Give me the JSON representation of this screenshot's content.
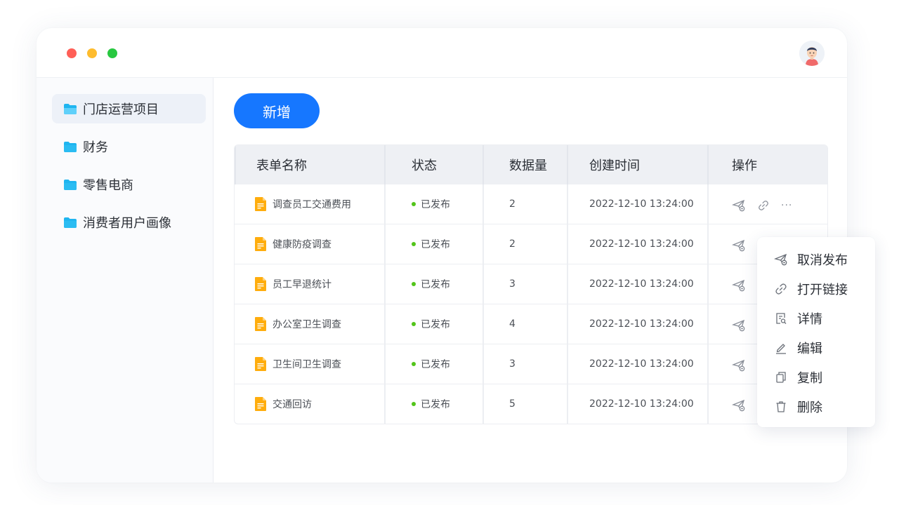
{
  "window": {
    "controls": [
      "close",
      "minimize",
      "maximize"
    ]
  },
  "sidebar": {
    "items": [
      {
        "label": "门店运营项目",
        "active": true,
        "icon": "folder-open-icon"
      },
      {
        "label": "财务",
        "active": false,
        "icon": "folder-icon"
      },
      {
        "label": "零售电商",
        "active": false,
        "icon": "folder-icon"
      },
      {
        "label": "消费者用户画像",
        "active": false,
        "icon": "folder-icon"
      }
    ]
  },
  "toolbar": {
    "add_label": "新增"
  },
  "table": {
    "headers": [
      "表单名称",
      "状态",
      "数据量",
      "创建时间",
      "操作"
    ],
    "rows": [
      {
        "name": "调查员工交通费用",
        "status": "已发布",
        "count": "2",
        "created": "2022-12-10 13:24:00"
      },
      {
        "name": "健康防疫调查",
        "status": "已发布",
        "count": "2",
        "created": "2022-12-10 13:24:00"
      },
      {
        "name": "员工早退统计",
        "status": "已发布",
        "count": "3",
        "created": "2022-12-10 13:24:00"
      },
      {
        "name": "办公室卫生调查",
        "status": "已发布",
        "count": "4",
        "created": "2022-12-10 13:24:00"
      },
      {
        "name": "卫生间卫生调查",
        "status": "已发布",
        "count": "3",
        "created": "2022-12-10 13:24:00"
      },
      {
        "name": "交通回访",
        "status": "已发布",
        "count": "5",
        "created": "2022-12-10 13:24:00"
      }
    ],
    "more_label": "···"
  },
  "menu": {
    "items": [
      {
        "label": "取消发布",
        "icon": "unpublish-icon"
      },
      {
        "label": "打开链接",
        "icon": "link-icon"
      },
      {
        "label": "详情",
        "icon": "details-icon"
      },
      {
        "label": "编辑",
        "icon": "edit-icon"
      },
      {
        "label": "复制",
        "icon": "copy-icon"
      },
      {
        "label": "删除",
        "icon": "delete-icon"
      }
    ]
  },
  "colors": {
    "primary": "#1677ff",
    "status_published": "#52c41a",
    "folder": "#1fb5f0",
    "doc": "#ffad0d"
  }
}
